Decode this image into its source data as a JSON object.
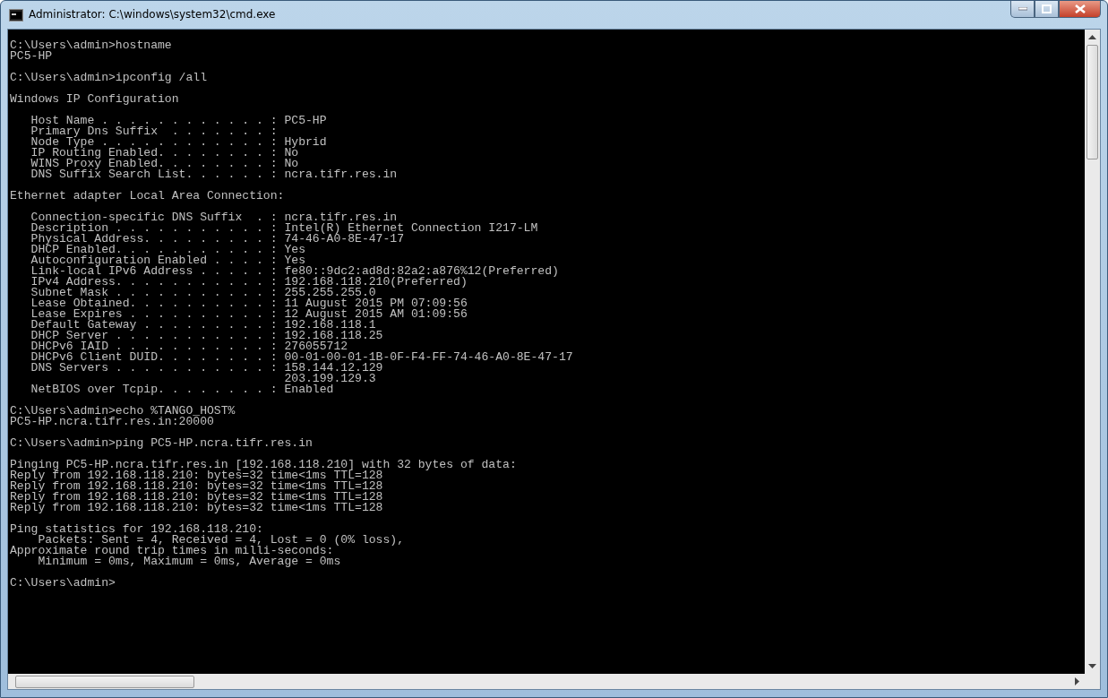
{
  "window": {
    "title": "Administrator: C:\\windows\\system32\\cmd.exe"
  },
  "console": {
    "blocks": [
      [
        "C:\\Users\\admin>hostname",
        "PC5-HP"
      ],
      [
        "C:\\Users\\admin>ipconfig /all"
      ],
      [
        "Windows IP Configuration"
      ],
      [
        "   Host Name . . . . . . . . . . . . : PC5-HP",
        "   Primary Dns Suffix  . . . . . . . :",
        "   Node Type . . . . . . . . . . . . : Hybrid",
        "   IP Routing Enabled. . . . . . . . : No",
        "   WINS Proxy Enabled. . . . . . . . : No",
        "   DNS Suffix Search List. . . . . . : ncra.tifr.res.in"
      ],
      [
        "Ethernet adapter Local Area Connection:"
      ],
      [
        "   Connection-specific DNS Suffix  . : ncra.tifr.res.in",
        "   Description . . . . . . . . . . . : Intel(R) Ethernet Connection I217-LM",
        "   Physical Address. . . . . . . . . : 74-46-A0-8E-47-17",
        "   DHCP Enabled. . . . . . . . . . . : Yes",
        "   Autoconfiguration Enabled . . . . : Yes",
        "   Link-local IPv6 Address . . . . . : fe80::9dc2:ad8d:82a2:a876%12(Preferred)",
        "   IPv4 Address. . . . . . . . . . . : 192.168.118.210(Preferred)",
        "   Subnet Mask . . . . . . . . . . . : 255.255.255.0",
        "   Lease Obtained. . . . . . . . . . : 11 August 2015 PM 07:09:56",
        "   Lease Expires . . . . . . . . . . : 12 August 2015 AM 01:09:56",
        "   Default Gateway . . . . . . . . . : 192.168.118.1",
        "   DHCP Server . . . . . . . . . . . : 192.168.118.25",
        "   DHCPv6 IAID . . . . . . . . . . . : 276055712",
        "   DHCPv6 Client DUID. . . . . . . . : 00-01-00-01-1B-0F-F4-FF-74-46-A0-8E-47-17",
        "   DNS Servers . . . . . . . . . . . : 158.144.12.129",
        "                                       203.199.129.3",
        "   NetBIOS over Tcpip. . . . . . . . : Enabled"
      ],
      [
        "C:\\Users\\admin>echo %TANGO_HOST%",
        "PC5-HP.ncra.tifr.res.in:20000"
      ],
      [
        "C:\\Users\\admin>ping PC5-HP.ncra.tifr.res.in"
      ],
      [
        "Pinging PC5-HP.ncra.tifr.res.in [192.168.118.210] with 32 bytes of data:",
        "Reply from 192.168.118.210: bytes=32 time<1ms TTL=128",
        "Reply from 192.168.118.210: bytes=32 time<1ms TTL=128",
        "Reply from 192.168.118.210: bytes=32 time<1ms TTL=128",
        "Reply from 192.168.118.210: bytes=32 time<1ms TTL=128"
      ],
      [
        "Ping statistics for 192.168.118.210:",
        "    Packets: Sent = 4, Received = 4, Lost = 0 (0% loss),",
        "Approximate round trip times in milli-seconds:",
        "    Minimum = 0ms, Maximum = 0ms, Average = 0ms"
      ],
      [
        "C:\\Users\\admin>"
      ]
    ]
  }
}
